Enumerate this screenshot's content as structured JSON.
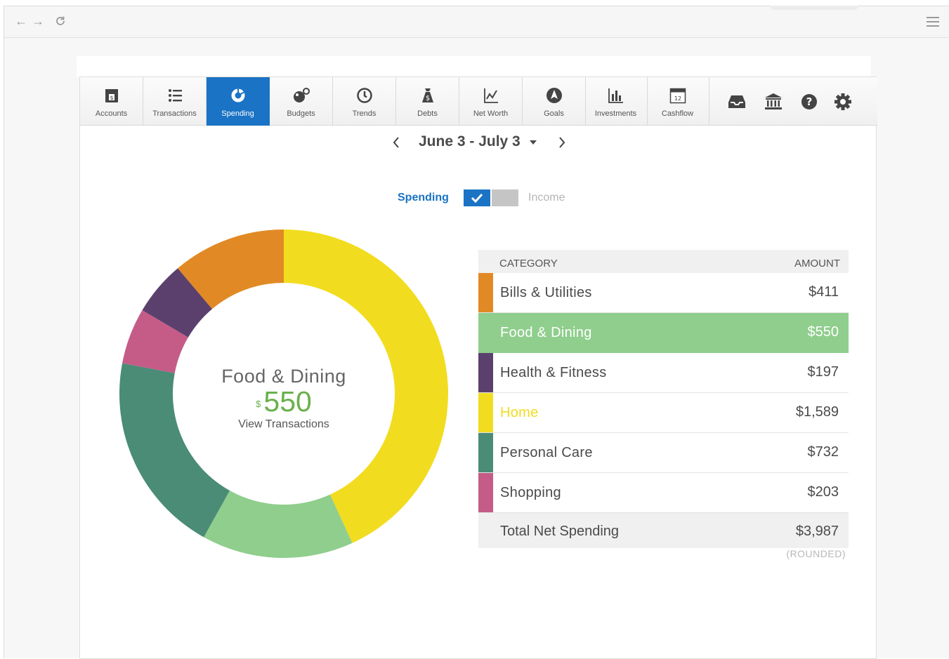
{
  "toolbar": {
    "tabs": [
      {
        "label": "Accounts",
        "icon": "wallet-icon"
      },
      {
        "label": "Transactions",
        "icon": "list-icon"
      },
      {
        "label": "Spending",
        "icon": "donut-chart-icon",
        "active": true
      },
      {
        "label": "Budgets",
        "icon": "budgets-icon"
      },
      {
        "label": "Trends",
        "icon": "clock-icon"
      },
      {
        "label": "Debts",
        "icon": "money-bag-icon"
      },
      {
        "label": "Net Worth",
        "icon": "line-chart-icon"
      },
      {
        "label": "Goals",
        "icon": "compass-icon"
      },
      {
        "label": "Investments",
        "icon": "bar-chart-icon"
      },
      {
        "label": "Cashflow",
        "icon": "calendar-icon",
        "calendar_day": "12"
      }
    ],
    "right_icons": [
      "inbox-icon",
      "bank-icon",
      "help-icon",
      "settings-gear-icon"
    ]
  },
  "date_range": {
    "label": "June 3 - July 3"
  },
  "toggle": {
    "spending_label": "Spending",
    "income_label": "Income",
    "selected": "spending"
  },
  "donut_center": {
    "category": "Food & Dining",
    "currency": "$",
    "amount": "550",
    "link": "View Transactions"
  },
  "chart_data": {
    "type": "pie",
    "donut": true,
    "slices": [
      {
        "label": "Home",
        "value": 1589,
        "color": "#f2dc1f"
      },
      {
        "label": "Food & Dining",
        "value": 550,
        "color": "#8fce8d"
      },
      {
        "label": "Personal Care",
        "value": 732,
        "color": "#4a8c76"
      },
      {
        "label": "Shopping",
        "value": 203,
        "color": "#c45c87"
      },
      {
        "label": "Health & Fitness",
        "value": 197,
        "color": "#5b406d"
      },
      {
        "label": "Bills & Utilities",
        "value": 411,
        "color": "#e18a25"
      }
    ]
  },
  "table": {
    "header_category": "CATEGORY",
    "header_amount": "AMOUNT",
    "rows": [
      {
        "category": "Bills & Utilities",
        "amount": "$411",
        "color": "#e18a25"
      },
      {
        "category": "Food & Dining",
        "amount": "$550",
        "color": "#8fce8d",
        "selected": true
      },
      {
        "category": "Health & Fitness",
        "amount": "$197",
        "color": "#5b406d"
      },
      {
        "category": "Home",
        "amount": "$1,589",
        "color": "#f2dc1f",
        "highlight_text": true
      },
      {
        "category": "Personal Care",
        "amount": "$732",
        "color": "#4a8c76"
      },
      {
        "category": "Shopping",
        "amount": "$203",
        "color": "#c45c87"
      }
    ],
    "total_label": "Total Net Spending",
    "total_amount": "$3,987",
    "footnote": "(ROUNDED)"
  }
}
